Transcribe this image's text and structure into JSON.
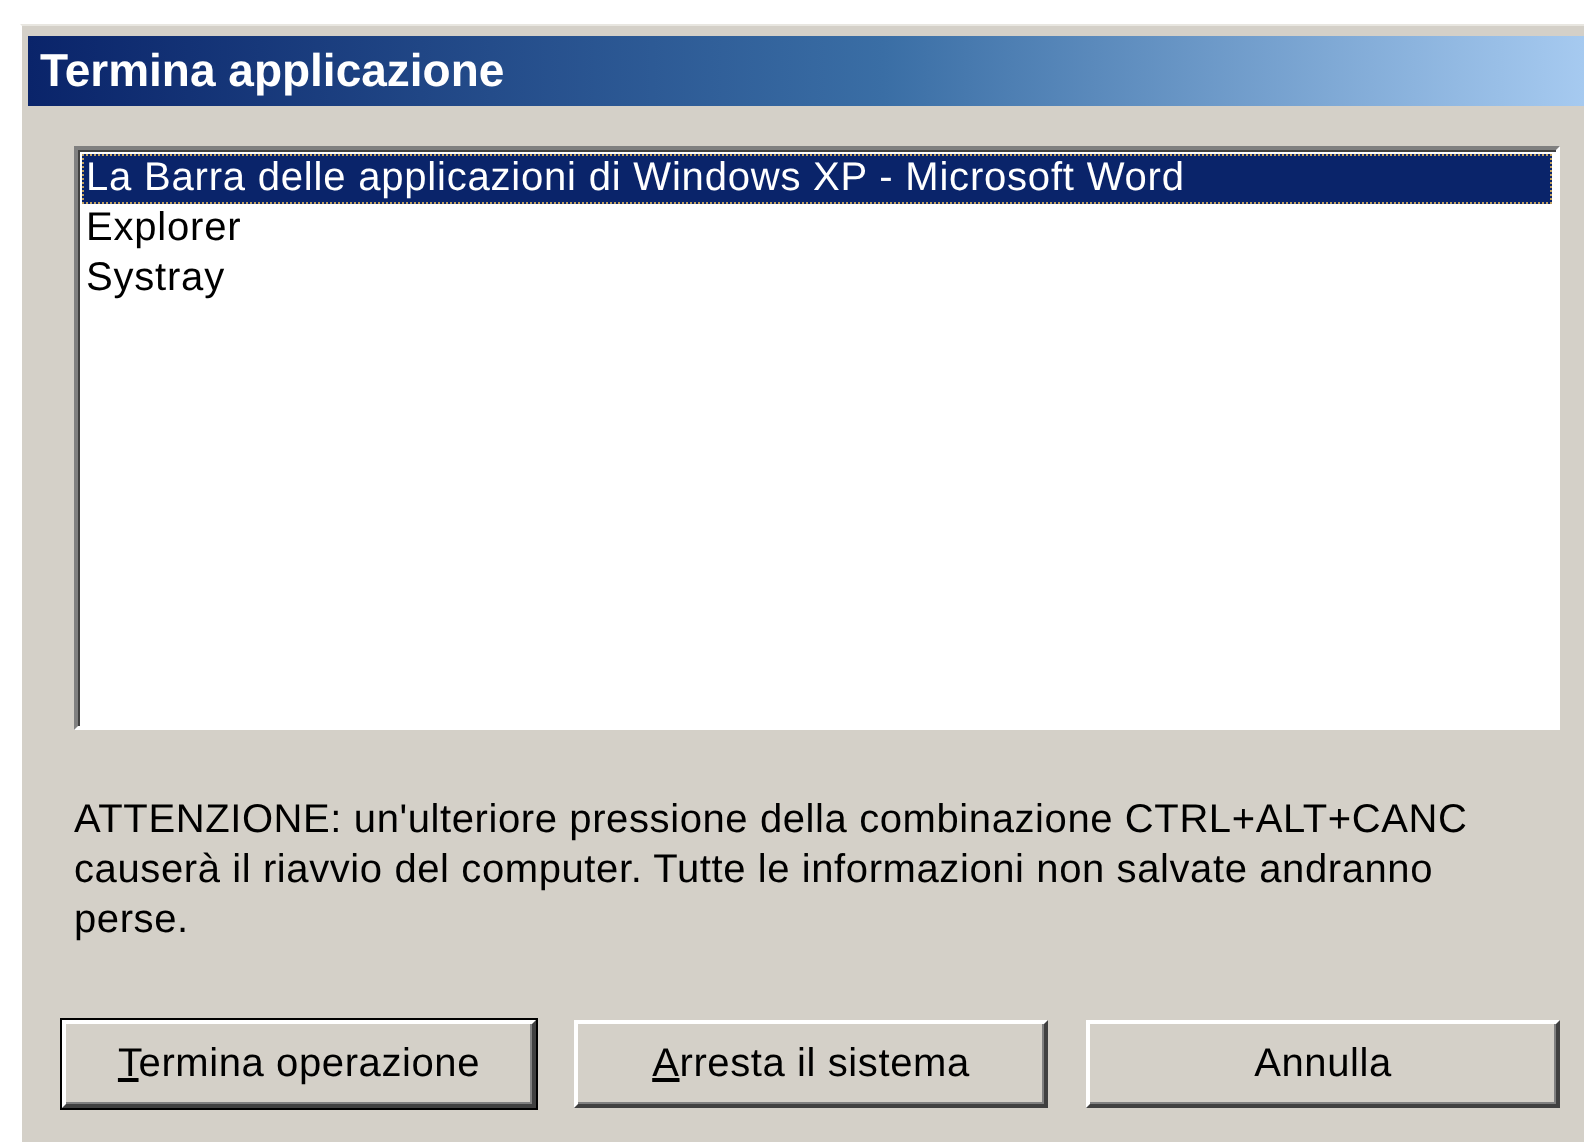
{
  "window": {
    "title": "Termina applicazione"
  },
  "tasks": [
    {
      "label": "La Barra delle applicazioni di Windows XP - Microsoft Word",
      "selected": true
    },
    {
      "label": "Explorer",
      "selected": false
    },
    {
      "label": "Systray",
      "selected": false
    }
  ],
  "warning": "ATTENZIONE: un'ulteriore pressione della combinazione CTRL+ALT+CANC causerà il riavvio del computer. Tutte le informazioni non salvate andranno perse.",
  "buttons": [
    {
      "label_parts": [
        {
          "text": "T",
          "underlined": true
        },
        {
          "text": "ermina operazione",
          "underlined": false
        }
      ],
      "default": true
    },
    {
      "label_parts": [
        {
          "text": "A",
          "underlined": true
        },
        {
          "text": "rresta il sistema",
          "underlined": false
        }
      ],
      "default": false
    },
    {
      "label_parts": [
        {
          "text": "Annulla",
          "underlined": false
        }
      ],
      "default": false
    }
  ]
}
